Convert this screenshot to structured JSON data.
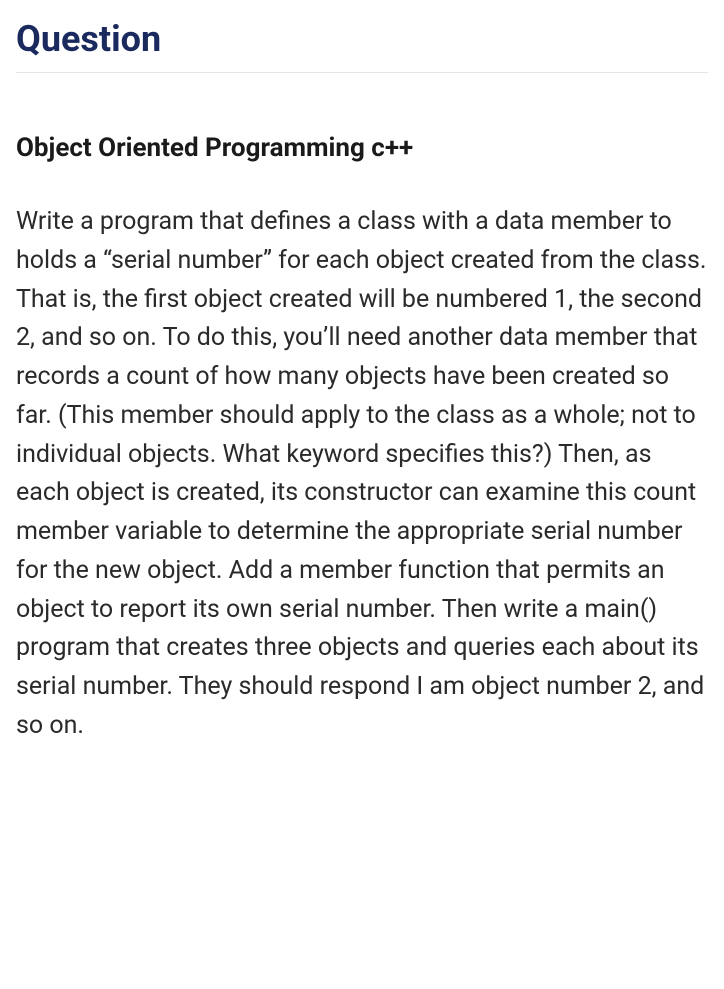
{
  "heading": "Question",
  "subject": "Object Oriented Programming c++",
  "body": "Write a program that defines a class with a data member to holds a “serial number” for each object created from the class. That is, the first object created will be numbered 1, the second 2, and so on. To do this, you’ll need another data member that records a count of how many objects have been created so far. (This member should apply to the class as a whole; not to individual objects. What keyword specifies this?) Then, as each object is created, its constructor can examine this count member variable to determine the appropriate serial number for the new object. Add a member function that permits an object to report its own serial number. Then write a main() program that creates three objects and queries each about its serial number. They should respond I am object number 2, and so on."
}
